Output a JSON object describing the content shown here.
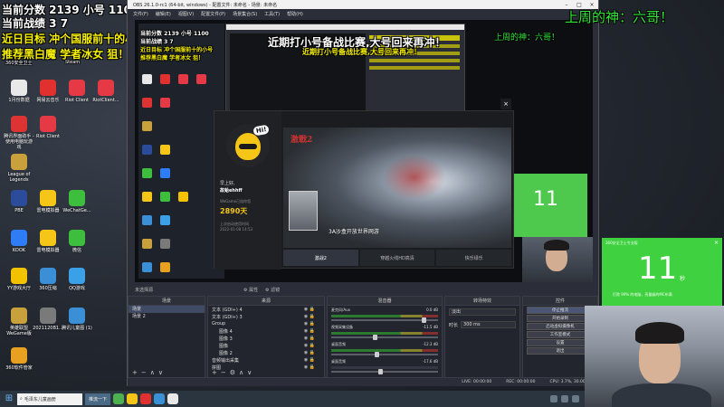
{
  "overlays": {
    "score_line": "当前分数 2139 小号 1100",
    "record_line": "当前战绩 3 7",
    "goal_line": "近日目标 冲个国服前十的小号",
    "recommend_line": "推荐黑白魔 学者冰女 狙！",
    "banner": "近期打小号备战比赛,大号回来再冲！",
    "green_slogan_top": "上周的神：六哥！",
    "green_slogan_inner": "上周的神：六哥！",
    "nested_score": "当前分数 2139 小号 1100",
    "nested_record": "当前战绩 3 7",
    "nested_goal": "近日目标 冲个国服前十的小号",
    "nested_recommend": "推荐黑白魔 学者冰女 狙！",
    "nested_banner": "近期打小号备战比赛,大号回来再冲！"
  },
  "desktop_icons": [
    {
      "label": "1月份数据",
      "color": "#e8e8e8"
    },
    {
      "label": "网易云音乐",
      "color": "#e03030"
    },
    {
      "label": "Riot Client",
      "color": "#e63946"
    },
    {
      "label": "RiotClient...",
      "color": "#e63946"
    },
    {
      "label": "腾讯界面助手 - 使用电脑玩游戏",
      "color": "#d33"
    },
    {
      "label": "Riot Client",
      "color": "#e63946"
    },
    {
      "label": "League of Legends",
      "color": "#c8a13c"
    },
    {
      "label": "PBE",
      "color": "#2b4c9a"
    },
    {
      "label": "雷电模拟器",
      "color": "#f5c518"
    },
    {
      "label": "WeChatGe...",
      "color": "#3dbf3d"
    },
    {
      "label": "KOOK",
      "color": "#2f7df6"
    },
    {
      "label": "雷电模拟器",
      "color": "#f5c518"
    },
    {
      "label": "微信",
      "color": "#3dbf3d"
    },
    {
      "label": "YY游戏大厅",
      "color": "#f2c200"
    },
    {
      "label": "360压缩",
      "color": "#3a8fd6"
    },
    {
      "label": "QQ游戏",
      "color": "#3aa0e8"
    },
    {
      "label": "英雄联盟WeGame版",
      "color": "#c8a13c"
    },
    {
      "label": "2021120B1...",
      "color": "#7a7a7a"
    },
    {
      "label": "腾讯儿童图 (1)",
      "color": "#3a8fd6"
    },
    {
      "label": "360软件管家",
      "color": "#e8a020"
    }
  ],
  "desktop_top_labels": [
    "360安全卫士",
    "Steam"
  ],
  "obs": {
    "title": "OBS 26.1.0-rc1 (64-bit, windows) - 配置文件: 未命名 - 场景: 未命名",
    "menu": [
      "文件(F)",
      "编辑(E)",
      "视图(V)",
      "配置文件(P)",
      "场景集合(S)",
      "工具(T)",
      "帮助(H)"
    ],
    "preview_label": "未选择源",
    "properties_label": "属性",
    "filters_label": "滤镜",
    "docks": {
      "scenes": {
        "title": "场景",
        "items": [
          "场景",
          "场景 2"
        ]
      },
      "sources": {
        "title": "来源",
        "items": [
          "文本 (GDI+) 4",
          "文本 (GDI+) 3",
          "Group",
          "图像 4",
          "图像 3",
          "图像",
          "图像 2",
          "音频输出采集",
          "拼图"
        ]
      },
      "mixer": {
        "title": "混音器",
        "channels": [
          {
            "name": "麦克风/Aux",
            "db": "0.0 dB"
          },
          {
            "name": "视频采集设备",
            "db": "-11.5 dB"
          },
          {
            "name": "桌面音频",
            "db": "-12.3 dB"
          },
          {
            "name": "桌面音频",
            "db": "-17.6 dB"
          }
        ]
      },
      "transitions": {
        "title": "转场特效",
        "type": "淡出",
        "duration_label": "时长",
        "duration": "300 ms"
      },
      "controls": {
        "title": "控件",
        "buttons": [
          "停止推流",
          "开始录制",
          "启动虚拟摄像机",
          "工作室模式",
          "设置",
          "退出"
        ]
      }
    },
    "status": {
      "live_label": "LIVE:",
      "live_time": "00:00:00",
      "rec_label": "REC:",
      "rec_time": "00:00:00",
      "cpu": "CPU: 3.7%, 30.00 fps"
    }
  },
  "popup": {
    "greeting": "早上好,",
    "username": "故蛤ehhff",
    "companion_label": "WeGame已陪你您",
    "days": "2890天",
    "last_login_label": "上次启动使用时间",
    "last_login_time": "2022-01-08 14:53",
    "hero_text": "3A沙盒开放世界网游",
    "tabs": [
      "激战2",
      "穿越火线HD高清",
      "快乐绿乐"
    ],
    "hi": "Hi!"
  },
  "green_widget": {
    "title": "360安全卫士专业版",
    "number": "11",
    "unit": "秒",
    "subtitle": "打败 99% 的电脑，亮量级的MC布满"
  },
  "nested_green_number": "11",
  "taskbar": {
    "search_placeholder": "毛泽东儿童画册",
    "items": [
      "推流一下"
    ],
    "colors": {
      "bg": "#2a3540"
    }
  }
}
